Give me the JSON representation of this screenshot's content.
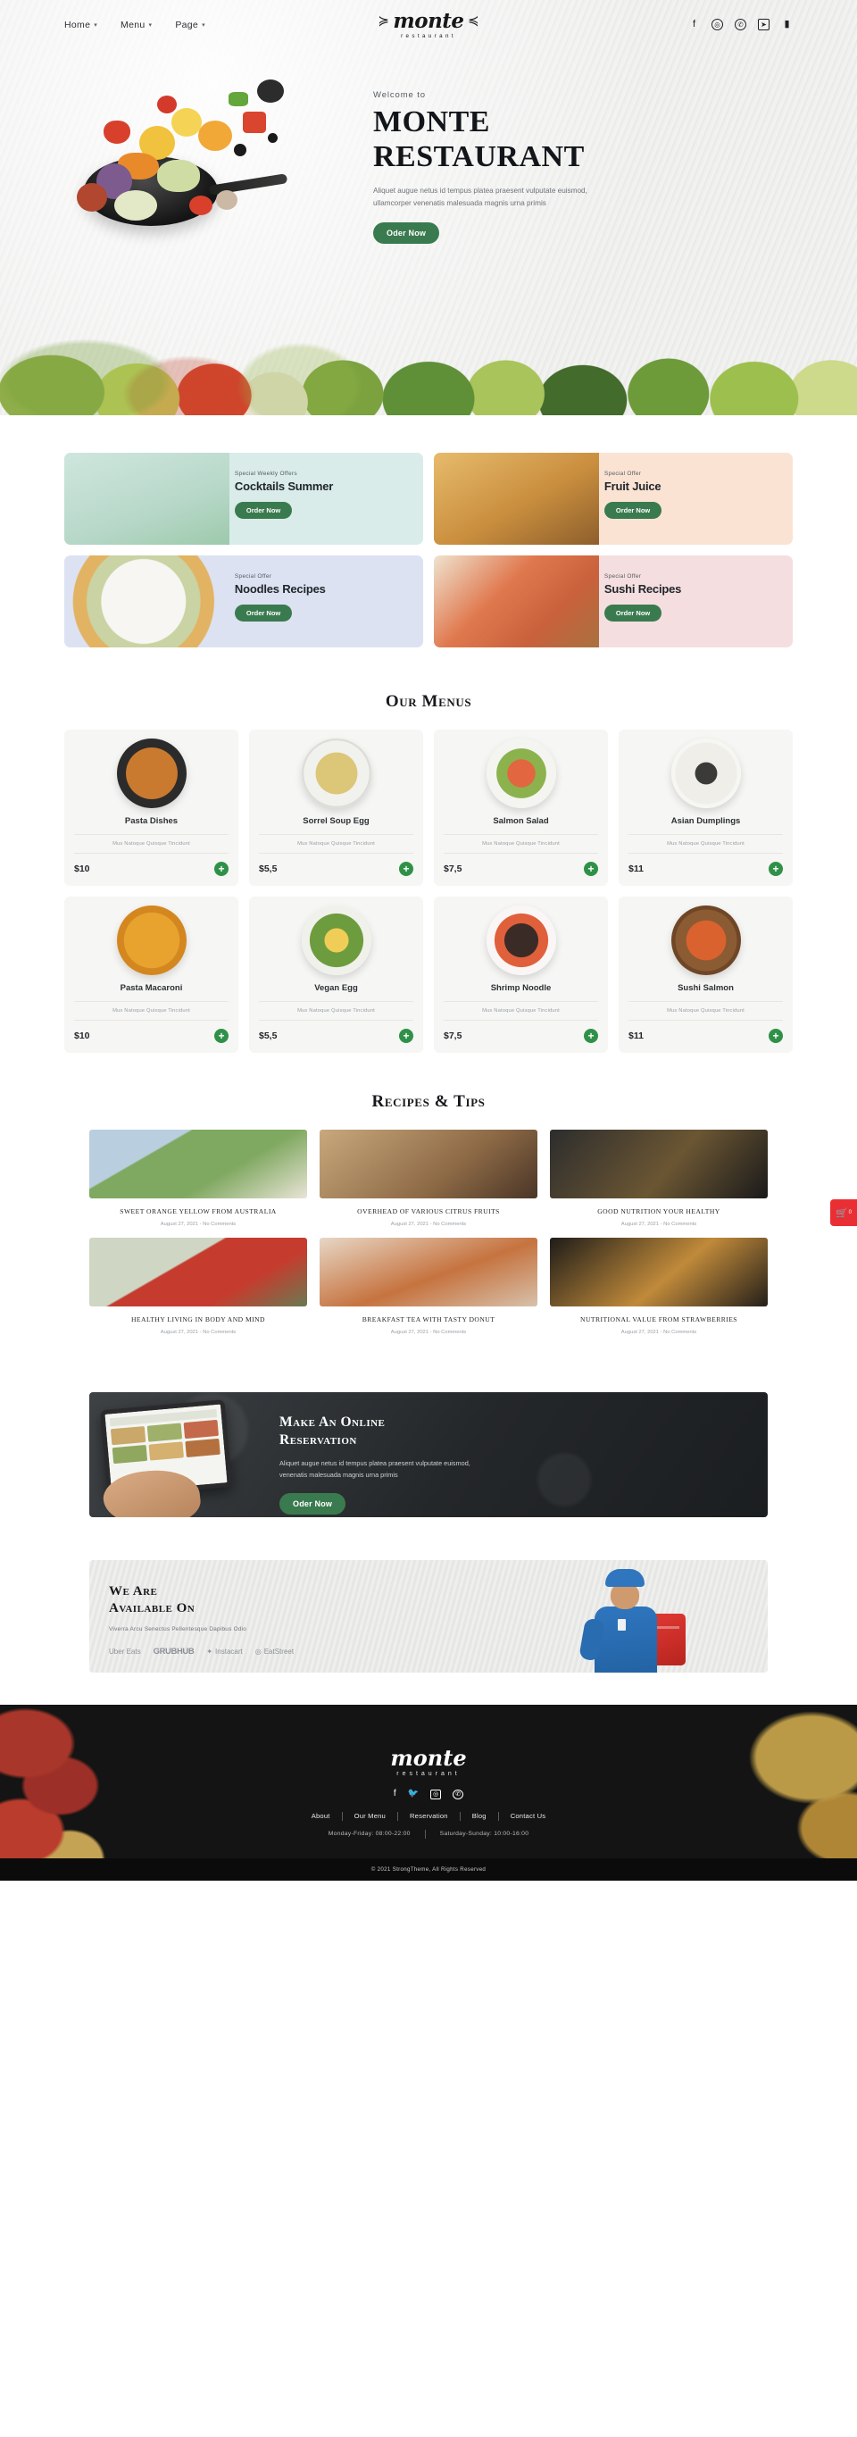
{
  "header": {
    "nav": [
      {
        "label": "Home",
        "caret": "▾"
      },
      {
        "label": "Menu",
        "caret": "▾"
      },
      {
        "label": "Page",
        "caret": "▾"
      }
    ],
    "logo": {
      "mark": "monte",
      "sub": "restaurant",
      "left_swoosh": "≽",
      "right_swoosh": "≼"
    },
    "socials": [
      {
        "name": "facebook-icon",
        "glyph": "f"
      },
      {
        "name": "instagram-icon",
        "glyph": "◎"
      },
      {
        "name": "whatsapp-icon",
        "glyph": "✆"
      },
      {
        "name": "telegram-icon",
        "glyph": "➤"
      },
      {
        "name": "pinterest-icon",
        "glyph": "▮"
      }
    ]
  },
  "hero": {
    "welcome": "Welcome to",
    "title_line1": "MONTE",
    "title_line2": "RESTAURANT",
    "description": "Aliquet augue netus id tempus platea praesent vulputate euismod, ullamcorper venenatis malesuada magnis urna primis",
    "cta": "Oder Now"
  },
  "promos": [
    {
      "kicker": "Special Weekly Offers",
      "title": "Cocktails Summer",
      "cta": "Order Now",
      "theme": "c-cocktail"
    },
    {
      "kicker": "Special Offer",
      "title": "Fruit Juice",
      "cta": "Order Now",
      "theme": "c-juice"
    },
    {
      "kicker": "Special Offer",
      "title": "Noodles Recipes",
      "cta": "Order Now",
      "theme": "c-noodle"
    },
    {
      "kicker": "Special Offer",
      "title": "Sushi Recipes",
      "cta": "Order Now",
      "theme": "c-sushi"
    }
  ],
  "menus": {
    "title": "Our Menus",
    "items": [
      {
        "name": "Pasta Dishes",
        "desc": "Mus Natoque Quisque Tincidunt",
        "price": "$10",
        "add": "+",
        "dish": "d-pasta"
      },
      {
        "name": "Sorrel Soup Egg",
        "desc": "Mus Natoque Quisque Tincidunt",
        "price": "$5,5",
        "add": "+",
        "dish": "d-soup"
      },
      {
        "name": "Salmon Salad",
        "desc": "Mus Natoque Quisque Tincidunt",
        "price": "$7,5",
        "add": "+",
        "dish": "d-salmon"
      },
      {
        "name": "Asian Dumplings",
        "desc": "Mus Natoque Quisque Tincidunt",
        "price": "$11",
        "add": "+",
        "dish": "d-dump"
      },
      {
        "name": "Pasta Macaroni",
        "desc": "Mus Natoque Quisque Tincidunt",
        "price": "$10",
        "add": "+",
        "dish": "d-macaroni"
      },
      {
        "name": "Vegan Egg",
        "desc": "Mus Natoque Quisque Tincidunt",
        "price": "$5,5",
        "add": "+",
        "dish": "d-vegan"
      },
      {
        "name": "Shrimp Noodle",
        "desc": "Mus Natoque Quisque Tincidunt",
        "price": "$7,5",
        "add": "+",
        "dish": "d-shrimp"
      },
      {
        "name": "Sushi Salmon",
        "desc": "Mus Natoque Quisque Tincidunt",
        "price": "$11",
        "add": "+",
        "dish": "d-sushi"
      }
    ]
  },
  "blog": {
    "title": "Recipes & Tips",
    "posts": [
      {
        "title": "SWEET ORANGE YELLOW FROM AUSTRALIA",
        "meta": "August 27, 2021 - No Comments",
        "thumb": "b1"
      },
      {
        "title": "OVERHEAD OF VARIOUS CITRUS FRUITS",
        "meta": "August 27, 2021 - No Comments",
        "thumb": "b2"
      },
      {
        "title": "GOOD NUTRITION YOUR HEALTHY",
        "meta": "August 27, 2021 - No Comments",
        "thumb": "b3"
      },
      {
        "title": "HEALTHY LIVING IN BODY AND MIND",
        "meta": "August 27, 2021 - No Comments",
        "thumb": "b4"
      },
      {
        "title": "BREAKFAST TEA WITH TASTY DONUT",
        "meta": "August 27, 2021 - No Comments",
        "thumb": "b5"
      },
      {
        "title": "NUTRITIONAL VALUE FROM STRAWBERRIES",
        "meta": "August 27, 2021 - No Comments",
        "thumb": "b6"
      }
    ]
  },
  "reservation": {
    "title_line1": "Make An Online",
    "title_line2": "Reservation",
    "description": "Aliquet augue netus id tempus platea praesent vulputate euismod, venenatis malesuada magnis urna primis",
    "cta": "Oder Now"
  },
  "available": {
    "title_line1": "We Are",
    "title_line2": "Available On",
    "description": "Viverra Arcu Senectus Pellentesque Dapibus Odio",
    "partners": [
      {
        "label": "Uber Eats",
        "icon": ""
      },
      {
        "label": "GRUBHUB",
        "icon": ""
      },
      {
        "label": "Instacart",
        "icon": "✦"
      },
      {
        "label": "EatStreet",
        "icon": "◎"
      }
    ]
  },
  "footer": {
    "logo": {
      "mark": "monte",
      "sub": "restaurant"
    },
    "socials": [
      {
        "name": "facebook-icon",
        "glyph": "f"
      },
      {
        "name": "twitter-icon",
        "glyph": "🐦"
      },
      {
        "name": "instagram-icon",
        "glyph": "◎"
      },
      {
        "name": "whatsapp-icon",
        "glyph": "✆"
      }
    ],
    "links": [
      "About",
      "Our Menu",
      "Reservation",
      "Blog",
      "Contact Us"
    ],
    "hours": [
      "Monday-Friday: 08:00-22:00",
      "Saturday-Sunday: 10:00-16:00"
    ],
    "copyright": "© 2021 StrongTheme, All Rights Reserved"
  },
  "cart": {
    "icon": "🛒",
    "count": "0"
  },
  "colors": {
    "green": "#3a7a4f",
    "add_green": "#2f9148",
    "cart_red": "#ea2f34",
    "dark": "#141414"
  }
}
